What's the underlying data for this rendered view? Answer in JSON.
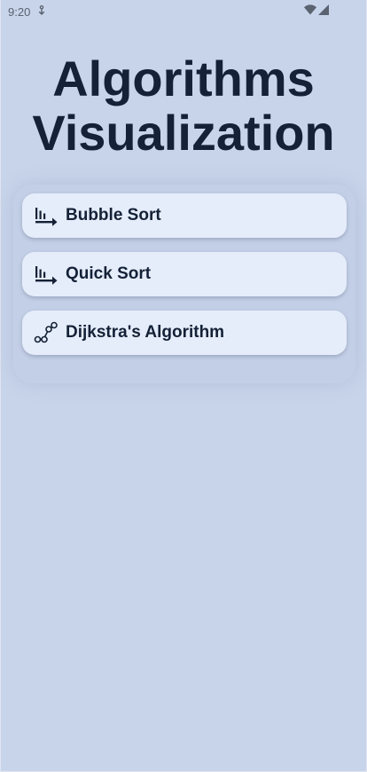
{
  "status_bar": {
    "time": "9:20",
    "notification_icon": "download-icon",
    "wifi_icon": "wifi-icon",
    "signal_icon": "signal-icon"
  },
  "app": {
    "title": "Algorithms Visualization"
  },
  "menu": {
    "items": [
      {
        "label": "Bubble Sort",
        "icon": "sort-bars-icon"
      },
      {
        "label": "Quick Sort",
        "icon": "sort-bars-icon"
      },
      {
        "label": "Dijkstra's Algorithm",
        "icon": "graph-path-icon"
      }
    ]
  },
  "colors": {
    "background": "#c8d4ea",
    "card": "#e5edfb",
    "text": "#142136"
  }
}
